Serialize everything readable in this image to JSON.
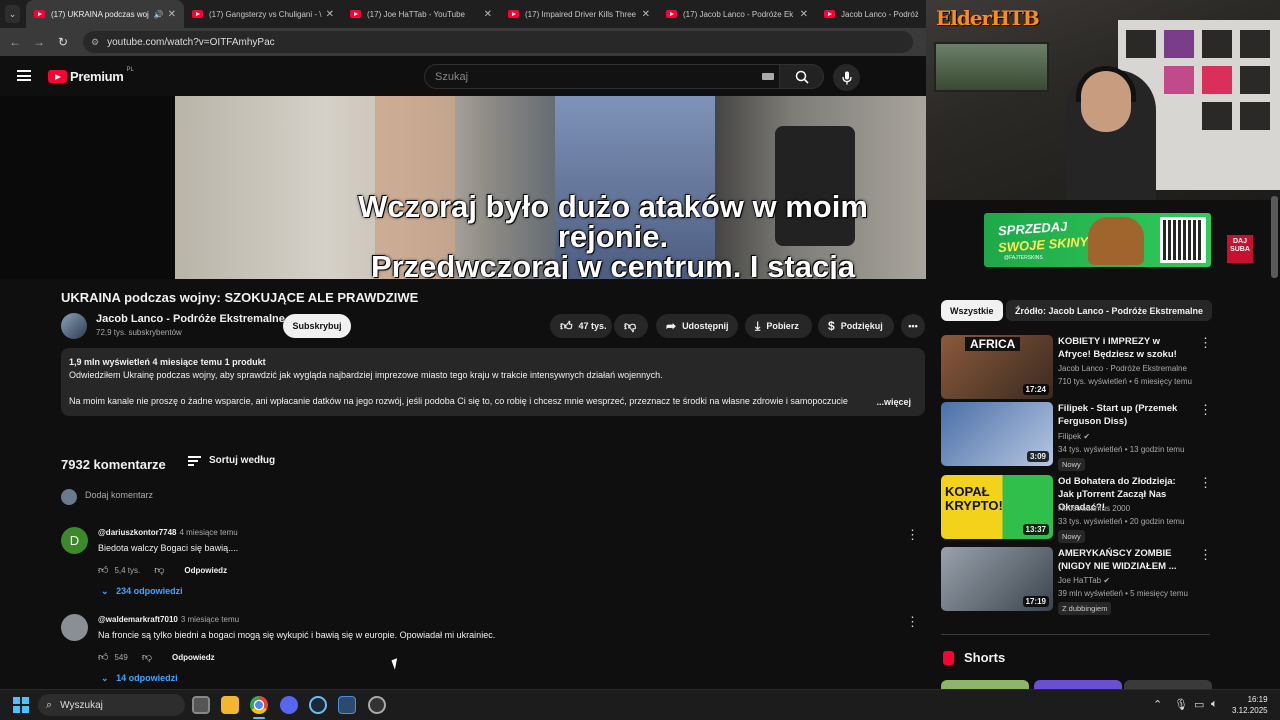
{
  "browser": {
    "tabs": [
      {
        "title": "(17) UKRAINA podczas woj",
        "active": true
      },
      {
        "title": "(17) Gangsterzy vs Chuligani - \\"
      },
      {
        "title": "(17) Joe HaTTab - YouTube"
      },
      {
        "title": "(17) Impaired Driver Kills Three"
      },
      {
        "title": "(17) Jacob Lanco - Podróże Ek"
      },
      {
        "title": "Jacob Lanco - Podróże E"
      }
    ],
    "url": "youtube.com/watch?v=OITFAmhyPac"
  },
  "youtube": {
    "logo": "Premium",
    "country": "PL",
    "search_placeholder": "Szukaj"
  },
  "video": {
    "subtitle_line1": "Wczoraj było dużo ataków w moim rejonie.",
    "subtitle_line2": "Przedwczoraj w centrum. I stacja kolejowa."
  },
  "overlay": {
    "streamer_logo": "ElderHTB",
    "ad_line1": "SPRZEDAJ",
    "ad_line2": "SWOJE SKINY",
    "ad_small": "@FAJTERSKINS",
    "side_badge": "DAJ SUBA"
  },
  "meta": {
    "title": "UKRAINA podczas wojny: SZOKUJĄCE ALE PRAWDZIWE",
    "channel": "Jacob Lanco - Podróże Ekstremalne",
    "subscribers": "72,9 tys. subskrybentów",
    "subscribe_label": "Subskrybuj",
    "likes": "47 tys.",
    "share_label": "Udostępnij",
    "download_label": "Pobierz",
    "thanks_label": "Podziękuj"
  },
  "description": {
    "stats": "1,9 mln wyświetleń  4 miesiące temu  1 produkt",
    "line1": "Odwiedziłem Ukrainę podczas wojny, aby sprawdzić jak wygląda najbardziej imprezowe miasto tego kraju w trakcie intensywnych działań wojennych.",
    "line2": "Na moim kanale nie proszę o żadne wsparcie, ani wpłacanie datków na jego rozwój, jeśli podoba Ci się to, co robię i chcesz mnie wesprzeć, przeznacz te środki na własne zdrowie i samopoczucie",
    "more": "...więcej"
  },
  "comments": {
    "count": "7932 komentarze",
    "sort_label": "Sortuj według",
    "add_placeholder": "Dodaj komentarz",
    "items": [
      {
        "initial": "D",
        "avatar_color": "#3a8a2a",
        "handle": "@dariuszkontor7748",
        "time": "4 miesiące temu",
        "text": "Biedota walczy Bogaci się bawią....",
        "likes": "5,4 tys.",
        "reply": "Odpowiedz",
        "replies": "234 odpowiedzi"
      },
      {
        "initial": "",
        "avatar_color": "#8a8f96",
        "handle": "@waldemarkraft7010",
        "time": "3 miesiące temu",
        "text": "Na froncie są tylko biedni a bogaci mogą się wykupić i bawią się w europie. Opowiadał mi ukrainiec.",
        "likes": "549",
        "reply": "Odpowiedz",
        "replies": "14 odpowiedzi"
      }
    ]
  },
  "sidebar": {
    "chip_all": "Wszystkie",
    "chip_source": "Źródło: Jacob Lanco - Podróże Ekstremalne",
    "recommendations": [
      {
        "title": "KOBIETY i IMPREZY w Afryce! Będziesz w szoku!",
        "channel": "Jacob Lanco - Podróże Ekstremalne",
        "meta": "710 tys. wyświetleń • 6 miesięcy temu",
        "duration": "17:24",
        "thumb_text": "AFRICA",
        "badge": ""
      },
      {
        "title": "Filipek - Start up (Przemek Ferguson Diss)",
        "channel": "Filipek",
        "meta": "34 tys. wyświetleń • 13 godzin temu",
        "duration": "3:09",
        "thumb_text": "",
        "badge": "Nowy"
      },
      {
        "title": "Od Bohatera do Złodzieja: Jak µTorrent Zaczął Nas Okradać?!",
        "channel": "Neostradamus 2000",
        "meta": "33 tys. wyświetleń • 20 godzin temu",
        "duration": "13:37",
        "thumb_text": "KOPAŁ KRYPTO!",
        "badge": "Nowy"
      },
      {
        "title": "AMERYKAŃSCY ZOMBIE (NIGDY NIE WIDZIAŁEM ...",
        "channel": "Joe HaTTab",
        "meta": "39 mln wyświetleń • 5 miesięcy temu",
        "duration": "17:19",
        "thumb_text": "",
        "badge": "Z dubbingiem"
      }
    ],
    "shorts_label": "Shorts"
  },
  "taskbar": {
    "search_label": "Wyszukaj",
    "time": "16:19",
    "date": "3.12.2025"
  }
}
